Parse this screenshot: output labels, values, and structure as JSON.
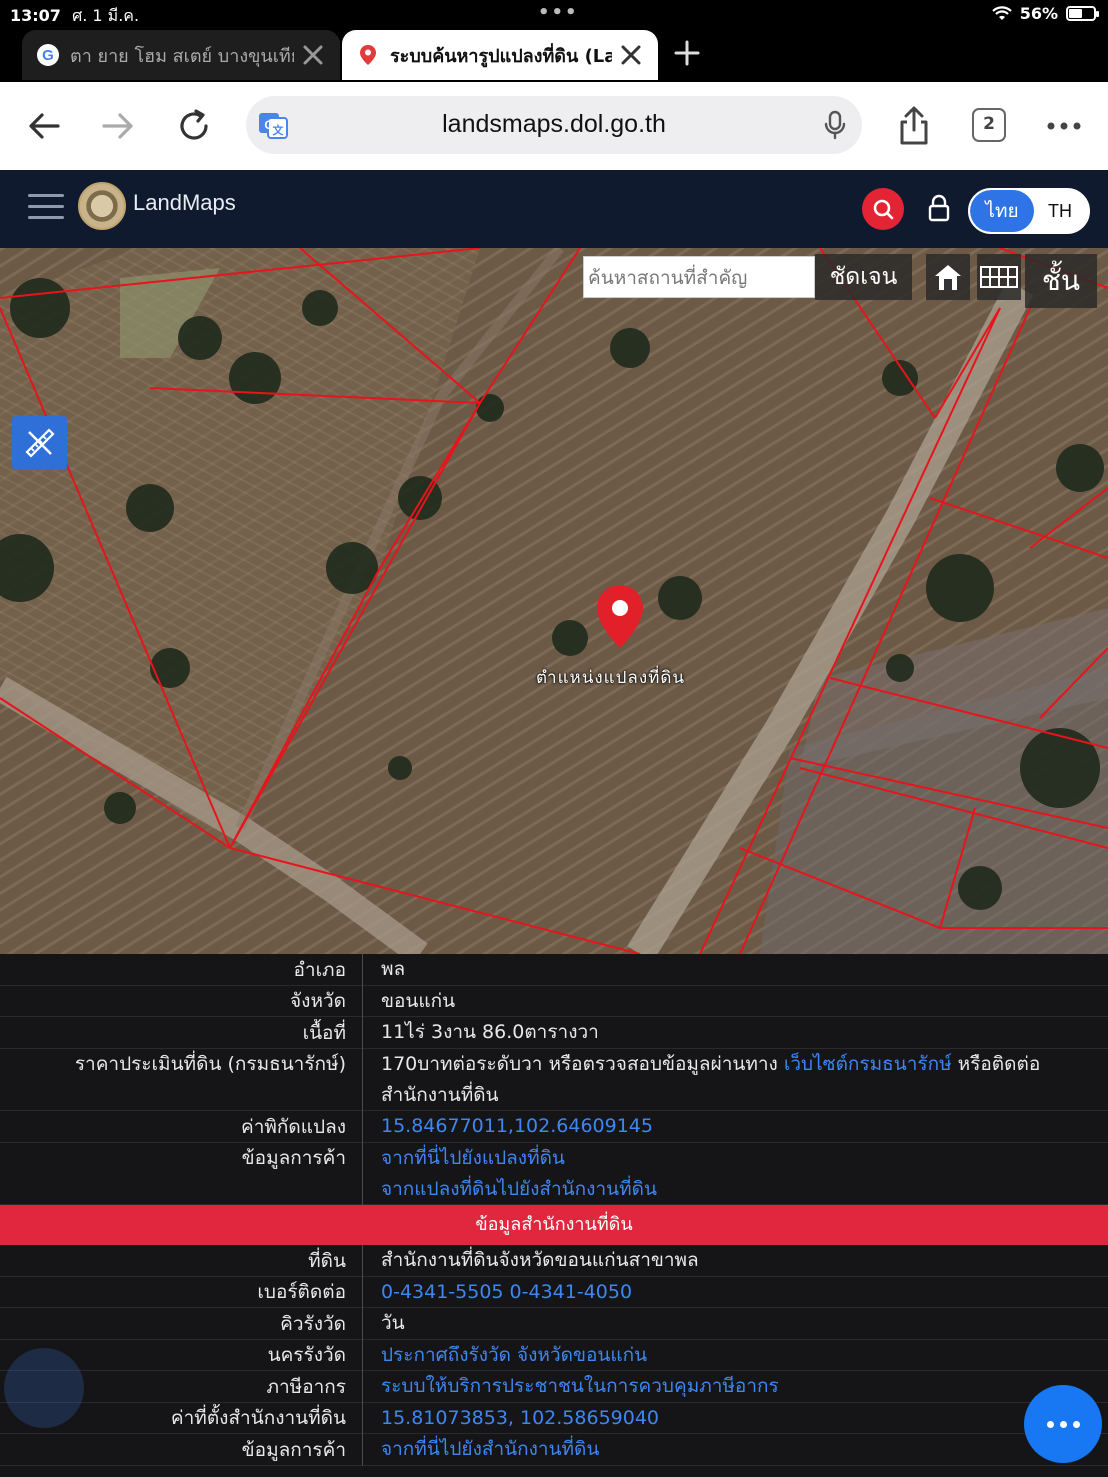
{
  "status": {
    "time": "13:07",
    "date": "ศ. 1 มี.ค.",
    "battery": "56%",
    "battery_level": 0.56
  },
  "tabs": [
    {
      "title": "ตา ยาย โฮม สเตย์ บางขุนเทีย",
      "active": false
    },
    {
      "title": "ระบบค้นหารูปแปลงที่ดิน (LandMaps)",
      "active": true
    }
  ],
  "toolbar": {
    "url": "landsmaps.dol.go.th",
    "tab_count": "2"
  },
  "app": {
    "brand": "LandMaps",
    "lang_th": "ไทย",
    "lang_en": "TH"
  },
  "map": {
    "search_placeholder": "ค้นหาสถานที่สำคัญ",
    "clear_label": "ชัดเจน",
    "layers_label": "ชั้น",
    "pin_label": "ตำแหน่งแปลงที่ดิน"
  },
  "info": {
    "rows": [
      {
        "key": "อำเภอ",
        "value": "พล"
      },
      {
        "key": "จังหวัด",
        "value": "ขอนแก่น"
      },
      {
        "key": "เนื้อที่",
        "value": "11ไร่ 3งาน 86.0ตารางวา"
      },
      {
        "key": "ราคาประเมินที่ดิน (กรมธนารักษ์)",
        "value_pre": "170บาทต่อระดับวา หรือตรวจสอบข้อมูลผ่านทาง ",
        "value_link": "เว็บไซต์กรมธนารักษ์",
        "value_post": " หรือติดต่อ",
        "value_line2": "สำนักงานที่ดิน"
      },
      {
        "key": "ค่าพิกัดแปลง",
        "link": "15.84677011,102.64609145"
      },
      {
        "key": "ข้อมูลการค้า",
        "link1": "จากที่นี่ไปยังแปลงที่ดิน",
        "link2": "จากแปลงที่ดินไปยังสำนักงานที่ดิน"
      }
    ],
    "section_title": "ข้อมูลสำนักงานที่ดิน",
    "office_rows": [
      {
        "key": "ที่ดิน",
        "value": "สำนักงานที่ดินจังหวัดขอนแก่นสาขาพล"
      },
      {
        "key": "เบอร์ติดต่อ",
        "link": "0-4341-5505 0-4341-4050"
      },
      {
        "key": "คิวรังวัด",
        "value": "วัน"
      },
      {
        "key": "นครรังวัด",
        "link": "ประกาศถึงรังวัด จังหวัดขอนแก่น"
      },
      {
        "key": "ภาษีอากร",
        "link": "ระบบให้บริการประชาชนในการควบคุมภาษีอากร"
      },
      {
        "key": "ค่าที่ตั้งสำนักงานที่ดิน",
        "link": "15.81073853, 102.58659040"
      },
      {
        "key": "ข้อมูลการค้า",
        "link": "จากที่นี่ไปยังสำนักงานที่ดิน"
      }
    ]
  }
}
